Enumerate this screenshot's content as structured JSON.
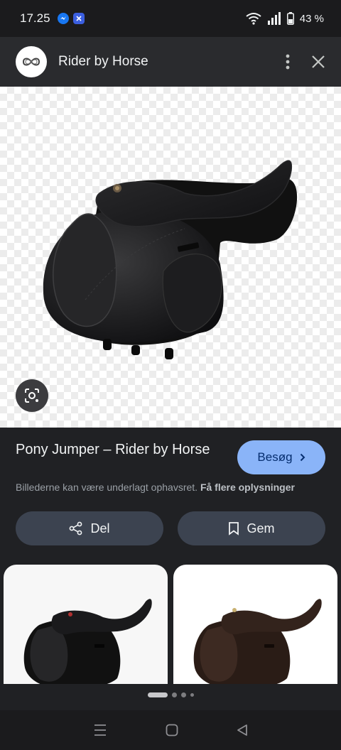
{
  "status": {
    "time": "17.25",
    "battery": "43 %",
    "notifications": [
      "messenger-icon",
      "app-notification-icon"
    ],
    "icons": [
      "wifi-icon",
      "signal-icon",
      "battery-icon"
    ]
  },
  "header": {
    "site_name": "Rider by Horse",
    "logo": "infinity-logo",
    "menu_icon": "more-vert-icon",
    "close_icon": "close-icon"
  },
  "image": {
    "lens_icon": "google-lens-icon"
  },
  "result": {
    "title": "Pony Jumper – Rider by Horse",
    "visit_label": "Besøg",
    "notice": "Billederne kan være underlagt ophavsret.",
    "notice_link": "Få flere oplysninger"
  },
  "actions": {
    "share_label": "Del",
    "save_label": "Gem"
  },
  "related": [
    {
      "tone": "black"
    },
    {
      "tone": "brown"
    }
  ],
  "pager": {
    "pages": 4,
    "active": 0
  },
  "colors": {
    "accent": "#8ab4f8",
    "background": "#202124",
    "button": "#3c4350"
  }
}
